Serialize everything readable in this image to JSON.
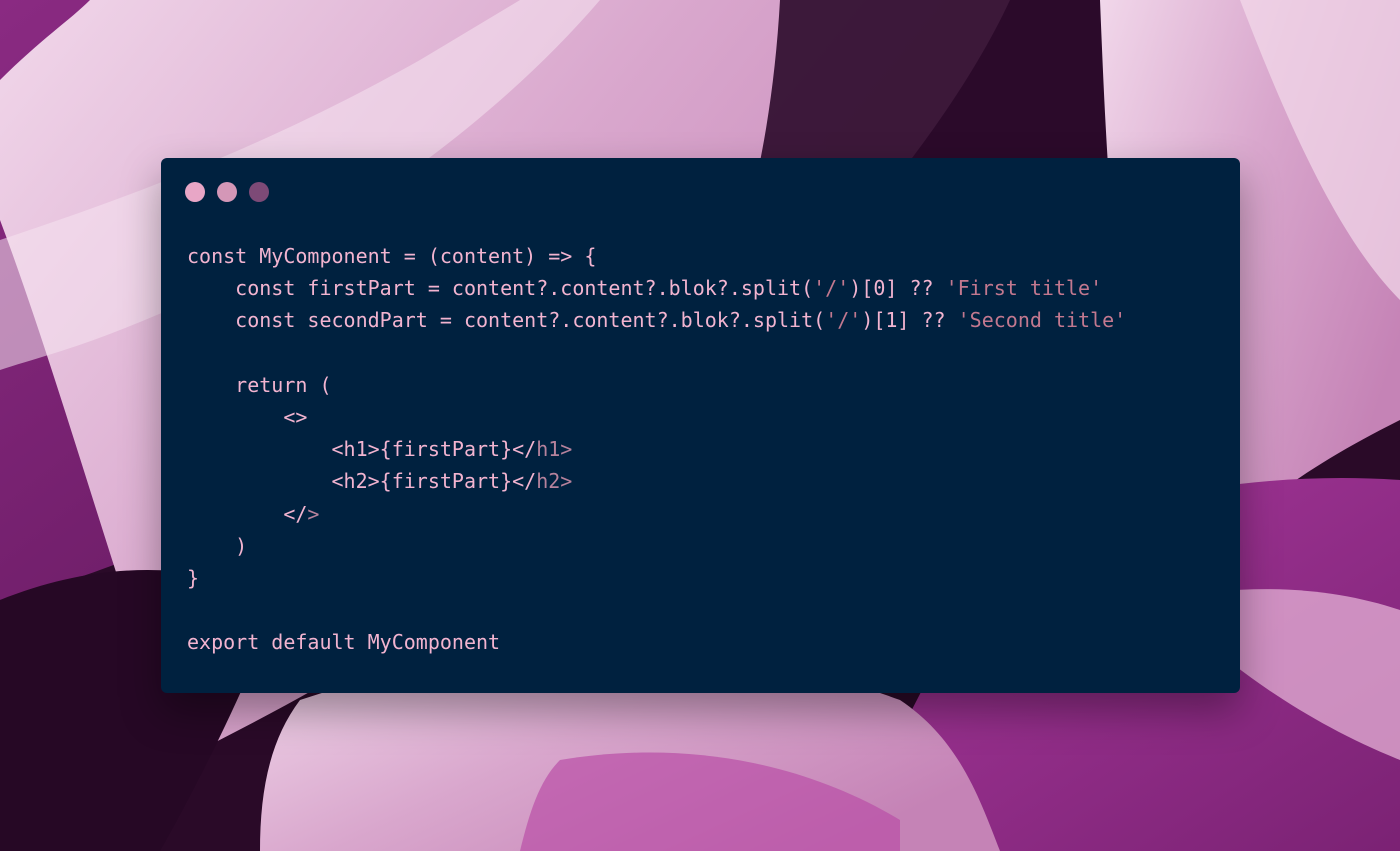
{
  "window": {
    "title": "",
    "controls": [
      "close",
      "minimize",
      "maximize"
    ]
  },
  "colors": {
    "editor_background": "#00213f",
    "code_text": "#f2b4d0",
    "string_text": "#c2788f",
    "closing_tag_text": "#b6829c",
    "close_dot": "#e8a6c6",
    "minimize_dot": "#d497b7",
    "maximize_dot": "#7d4a77"
  },
  "code": {
    "lines": [
      [
        {
          "t": "const MyComponent = (content) => {"
        }
      ],
      [
        {
          "t": "    const firstPart = content?.content?.blok?.split("
        },
        {
          "t": "'/'",
          "c": "str"
        },
        {
          "t": ")[0] ?? "
        },
        {
          "t": "'First title'",
          "c": "str"
        }
      ],
      [
        {
          "t": "    const secondPart = content?.content?.blok?.split("
        },
        {
          "t": "'/'",
          "c": "str"
        },
        {
          "t": ")[1] ?? "
        },
        {
          "t": "'Second title'",
          "c": "str"
        }
      ],
      [
        {
          "t": ""
        }
      ],
      [
        {
          "t": "    return ("
        }
      ],
      [
        {
          "t": "        <>"
        }
      ],
      [
        {
          "t": "            <h1>{firstPart}</"
        },
        {
          "t": "h1>",
          "c": "tag"
        }
      ],
      [
        {
          "t": "            <h2>{firstPart}</"
        },
        {
          "t": "h2>",
          "c": "tag"
        }
      ],
      [
        {
          "t": "        </"
        },
        {
          "t": ">",
          "c": "tag"
        }
      ],
      [
        {
          "t": "    )"
        }
      ],
      [
        {
          "t": "}"
        }
      ],
      [
        {
          "t": ""
        }
      ],
      [
        {
          "t": "export default MyComponent"
        }
      ]
    ]
  }
}
